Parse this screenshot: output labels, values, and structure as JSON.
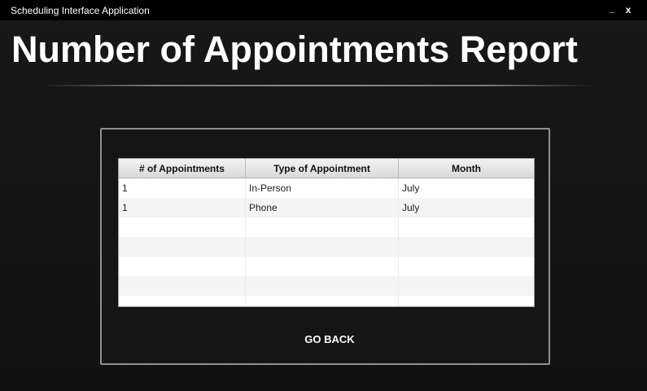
{
  "window": {
    "title": "Scheduling Interface Application",
    "minimize_label": "_",
    "close_label": "x"
  },
  "page": {
    "heading": "Number of Appointments Report"
  },
  "table": {
    "columns": [
      "# of Appointments",
      "Type of Appointment",
      "Month"
    ],
    "rows": [
      [
        "1",
        "In-Person",
        "July"
      ],
      [
        "1",
        "Phone",
        "July"
      ]
    ],
    "empty_rows": 5
  },
  "actions": {
    "go_back_label": "GO BACK"
  },
  "colors": {
    "background": "#151515",
    "titlebar": "#000000",
    "text": "#ffffff",
    "panel_border": "#8f8f8f"
  }
}
